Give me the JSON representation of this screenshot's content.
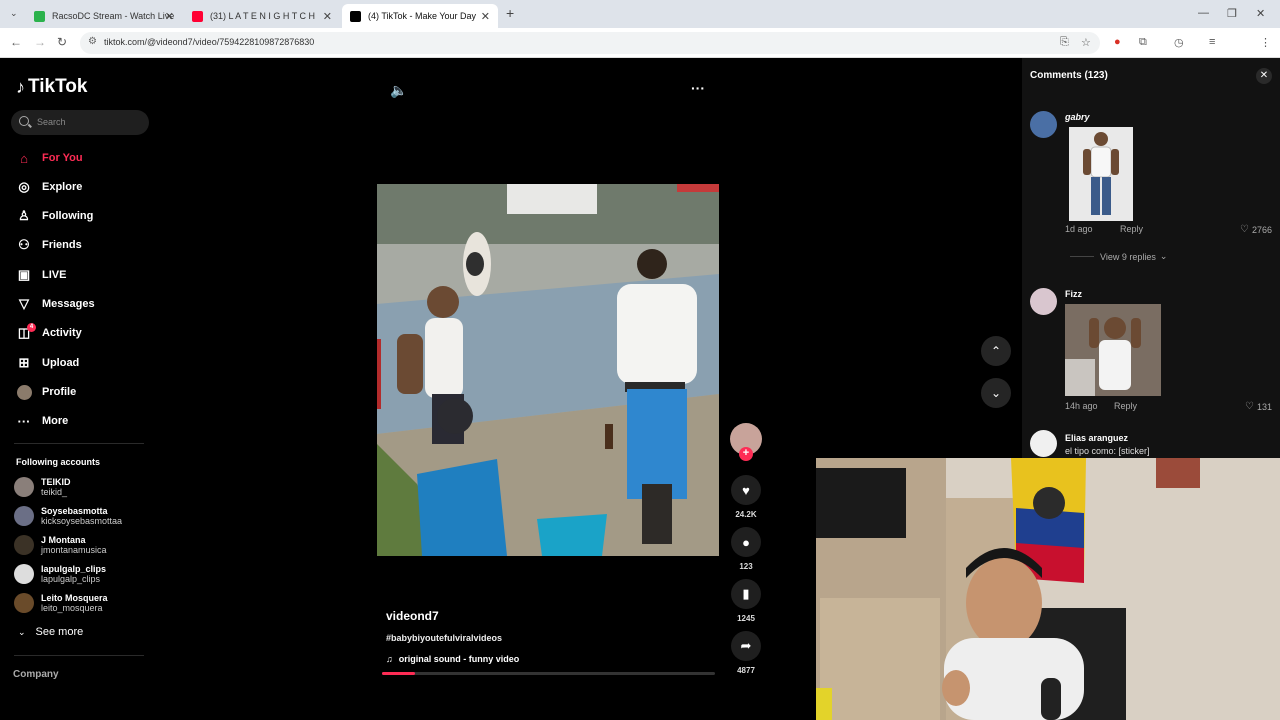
{
  "browser": {
    "tabs": [
      {
        "label": "RacsoDC Stream - Watch Live o",
        "color": "#2bb24c"
      },
      {
        "label": "(31) L A T E N I G H T C H",
        "color": "#ff0033"
      },
      {
        "label": "(4) TikTok - Make Your Day",
        "color": "#000000"
      }
    ],
    "new_tab": "+",
    "url": "tiktok.com/@videond7/video/7594228109872876830",
    "profile_initial": "O"
  },
  "sidebar": {
    "logo": "TikTok",
    "search_placeholder": "Search",
    "nav": [
      {
        "label": "For You",
        "icon": "home-icon"
      },
      {
        "label": "Explore",
        "icon": "compass-icon"
      },
      {
        "label": "Following",
        "icon": "following-icon"
      },
      {
        "label": "Friends",
        "icon": "friends-icon"
      },
      {
        "label": "LIVE",
        "icon": "live-icon"
      },
      {
        "label": "Messages",
        "icon": "messages-icon"
      },
      {
        "label": "Activity",
        "icon": "activity-icon",
        "badge": "4"
      },
      {
        "label": "Upload",
        "icon": "upload-icon"
      },
      {
        "label": "Profile",
        "icon": "profile-icon"
      },
      {
        "label": "More",
        "icon": "more-icon"
      }
    ],
    "following_title": "Following accounts",
    "accounts": [
      {
        "name": "TEIKID",
        "handle": "teikid_",
        "color": "#8a7f7a"
      },
      {
        "name": "Soysebasmotta",
        "handle": "kicksoysebasmottaa",
        "color": "#6b6f86"
      },
      {
        "name": "J Montana",
        "handle": "jmontanamusica",
        "color": "#3b3226"
      },
      {
        "name": "lapulgalp_clips",
        "handle": "lapulgalp_clips",
        "color": "#dddddd"
      },
      {
        "name": "Leito Mosquera",
        "handle": "leito_mosquera",
        "color": "#6a4b2a"
      }
    ],
    "see_more": "See more",
    "company": "Company"
  },
  "video": {
    "username": "videond7",
    "hashtag": "#babybiyoutefulviralvideos",
    "sound": "original sound - funny video",
    "progress": 0.1,
    "likes": "24.2K",
    "comments": "123",
    "saves": "1245",
    "shares": "4877"
  },
  "comments": {
    "title": "Comments (123)",
    "items": [
      {
        "user": "gabry",
        "time": "1d ago",
        "reply": "Reply",
        "likes": "2766",
        "view_replies": "View 9 replies"
      },
      {
        "user": "Fizz",
        "time": "14h ago",
        "reply": "Reply",
        "likes": "131"
      },
      {
        "user": "Elias aranguez",
        "text": "el tipo como: [sticker]"
      }
    ]
  }
}
